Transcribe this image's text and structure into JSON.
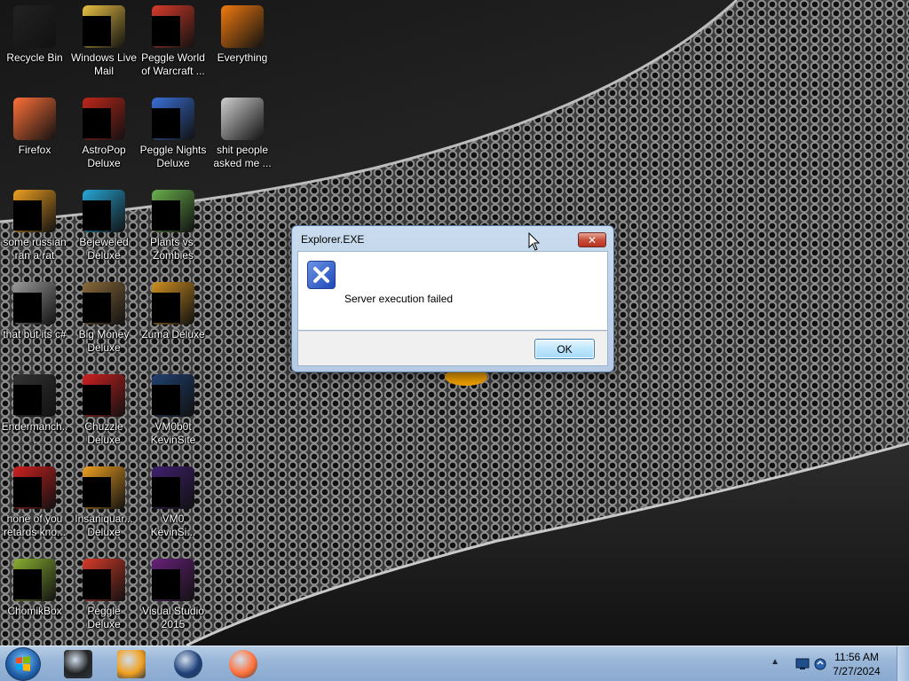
{
  "desktop_icons": [
    {
      "label": "Recycle Bin",
      "icon": "recycle-bin-icon",
      "color": "#222222"
    },
    {
      "label": "Windows Live Mail",
      "icon": "mail-icon",
      "color": "#e8c043"
    },
    {
      "label": "Peggle World of Warcraft ...",
      "icon": "peggle-icon",
      "color": "#d83b2a"
    },
    {
      "label": "Everything",
      "icon": "search-icon",
      "color": "#f07a10"
    },
    {
      "label": "Firefox",
      "icon": "firefox-icon",
      "color": "#ff7139"
    },
    {
      "label": "AstroPop Deluxe",
      "icon": "astropop-icon",
      "color": "#c0261b"
    },
    {
      "label": "Peggle Nights Deluxe",
      "icon": "peggle-nights-icon",
      "color": "#3a6fd8"
    },
    {
      "label": "shit people asked me ...",
      "icon": "folder-icon",
      "color": "#cfcfcf"
    },
    {
      "label": "some russian ran a rat",
      "icon": "file-icon",
      "color": "#f0a020"
    },
    {
      "label": "Bejeweled Deluxe",
      "icon": "bejeweled-icon",
      "color": "#27a7d8"
    },
    {
      "label": "Plants vs. Zombies",
      "icon": "pvz-icon",
      "color": "#6ab04c"
    },
    {
      "label": "that but its c#",
      "icon": "folder-icon",
      "color": "#9a9a9a"
    },
    {
      "label": "Big Money Deluxe",
      "icon": "big-money-icon",
      "color": "#8a6a3a"
    },
    {
      "label": "Zuma Deluxe",
      "icon": "zuma-icon",
      "color": "#d09020"
    },
    {
      "label": "Endermanch...",
      "icon": "window-icon",
      "color": "#333333"
    },
    {
      "label": "Chuzzle Deluxe",
      "icon": "chuzzle-icon",
      "color": "#d02020"
    },
    {
      "label": "VM0b0t KevinSite",
      "icon": "app-icon",
      "color": "#204070"
    },
    {
      "label": "none of you retards kno...",
      "icon": "app-icon",
      "color": "#d02020"
    },
    {
      "label": "Insaniquar... Deluxe",
      "icon": "fish-icon",
      "color": "#f0a020"
    },
    {
      "label": "VM0 KevinSi...",
      "icon": "app-icon",
      "color": "#402070"
    },
    {
      "label": "ChomikBox",
      "icon": "chomikbox-icon",
      "color": "#8ab030"
    },
    {
      "label": "Peggle Deluxe",
      "icon": "peggle-deluxe-icon",
      "color": "#d83b2a"
    },
    {
      "label": "Visual Studio 2015",
      "icon": "visual-studio-icon",
      "color": "#68217a"
    }
  ],
  "dialog": {
    "title": "Explorer.EXE",
    "close_label": "✕",
    "message": "Server execution failed",
    "ok_label": "OK",
    "icon": "error-icon"
  },
  "taskbar": {
    "pinned": [
      {
        "name": "terminal-icon",
        "color": "#222222"
      },
      {
        "name": "media-player-icon",
        "color": "#f0a020"
      },
      {
        "name": "globe-icon",
        "color": "#1d3f78"
      },
      {
        "name": "firefox-icon",
        "color": "#ff7139"
      }
    ],
    "clock_time": "11:56 AM",
    "clock_date": "7/27/2024",
    "tray_arrow": "▲"
  }
}
